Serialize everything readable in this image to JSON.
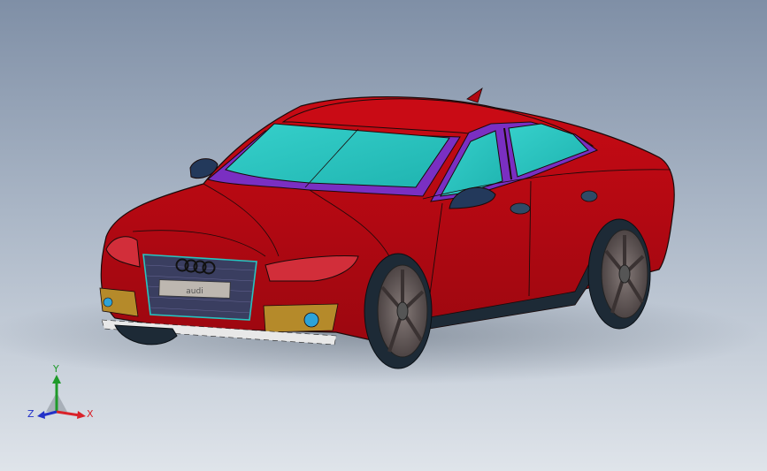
{
  "viewport": {
    "background_top": "#7f8fa6",
    "background_bottom": "#dfe4ea"
  },
  "model": {
    "body_color": "#c0060f",
    "body_shade": "#8e0a12",
    "glass_color": "#27c4c0",
    "trim_color": "#7a2fc2",
    "headlight_color": "#d22e3a",
    "fog_panel_color": "#b58a2a",
    "wheel_color": "#6a5f5f",
    "tire_color": "#1d2a36",
    "grille_color": "#3a3e60"
  },
  "grille": {
    "badge": "AUDI",
    "plate": "audi"
  },
  "triad": {
    "x_label": "X",
    "y_label": "Y",
    "z_label": "Z",
    "x_color": "#d9222a",
    "y_color": "#1f9a2a",
    "z_color": "#2332c8"
  }
}
